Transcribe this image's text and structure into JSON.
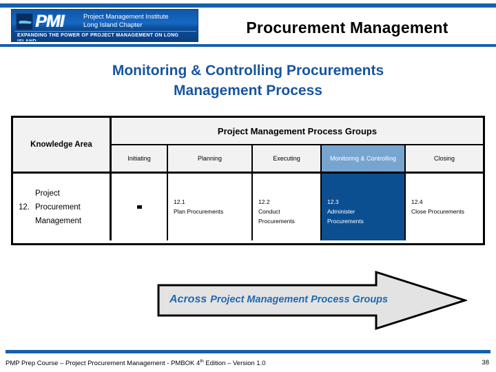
{
  "slide": {
    "title": "Procurement Management",
    "subtitle_line1": "Monitoring & Controlling Procurements",
    "subtitle_line2": "Management Process"
  },
  "logo": {
    "mark_text": "PMI",
    "org_line1": "Project Management Institute",
    "org_line2": "Long Island Chapter",
    "tagline": "Expanding the Power of Project Management on Long Island"
  },
  "matrix": {
    "knowledge_area_header": "Knowledge Area",
    "process_groups_header": "Project Management Process Groups",
    "columns": [
      {
        "label": "Initiating",
        "highlight": false
      },
      {
        "label": "Planning",
        "highlight": false
      },
      {
        "label": "Executing",
        "highlight": false
      },
      {
        "label": "Monitoring & Controlling",
        "highlight": true
      },
      {
        "label": "Closing",
        "highlight": false
      }
    ],
    "row": {
      "number": "12.",
      "name_line1": "Project",
      "name_line2": "Procurement",
      "name_line3": "Management",
      "cells": [
        {
          "code": "",
          "name": "",
          "dash": true,
          "highlight": false
        },
        {
          "code": "12.1",
          "name": "Plan Procurements",
          "dash": false,
          "highlight": false
        },
        {
          "code": "12.2",
          "name_line1": "Conduct",
          "name_line2": "Procurements",
          "dash": false,
          "highlight": false
        },
        {
          "code": "12.3",
          "name_line1": "Administer",
          "name_line2": "Procurements",
          "dash": false,
          "highlight": true
        },
        {
          "code": "12.4",
          "name": "Close Procurements",
          "dash": false,
          "highlight": false
        }
      ]
    }
  },
  "banner": {
    "lead": "Across",
    "rest": "Project Management Process Groups"
  },
  "footer": {
    "text_before": "PMP Prep Course – Project Procurement Management - PMBOK 4",
    "superscript": "th",
    "text_after": " Edition – Version 1.0",
    "page_number": "38"
  },
  "colors": {
    "brand_blue": "#1560ac",
    "subtitle_blue": "#17559e",
    "highlight_header": "#77a5cf",
    "highlight_cell": "#0b4f91",
    "header_fill": "#f2f2f2",
    "arrow_fill": "#e3e3e3"
  }
}
